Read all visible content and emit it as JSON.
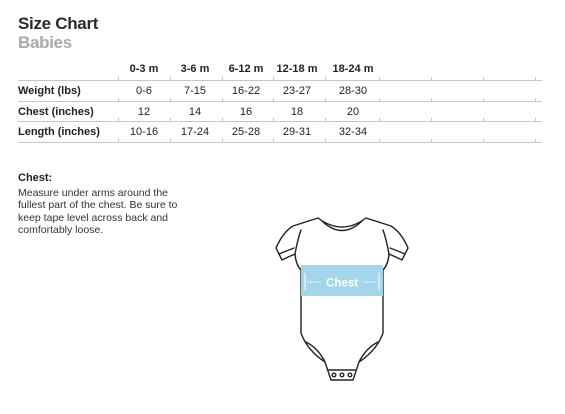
{
  "chart": {
    "title": "Size Chart",
    "subtitle": "Babies"
  },
  "table": {
    "columns": [
      "0-3 m",
      "3-6 m",
      "6-12 m",
      "12-18 m",
      "18-24 m"
    ],
    "rows": [
      {
        "label": "Weight (lbs)",
        "values": [
          "0-6",
          "7-15",
          "16-22",
          "23-27",
          "28-30"
        ]
      },
      {
        "label": "Chest (inches)",
        "values": [
          "12",
          "14",
          "16",
          "18",
          "20"
        ]
      },
      {
        "label": "Length (inches)",
        "values": [
          "10-16",
          "17-24",
          "25-28",
          "29-31",
          "32-34"
        ]
      }
    ]
  },
  "note": {
    "heading": "Chest:",
    "text": "Measure under arms around the fullest part of the chest. Be sure to keep tape level across back and comfortably loose."
  },
  "illustration": {
    "measure_label": "Chest",
    "band_color": "#a3d6ea"
  }
}
